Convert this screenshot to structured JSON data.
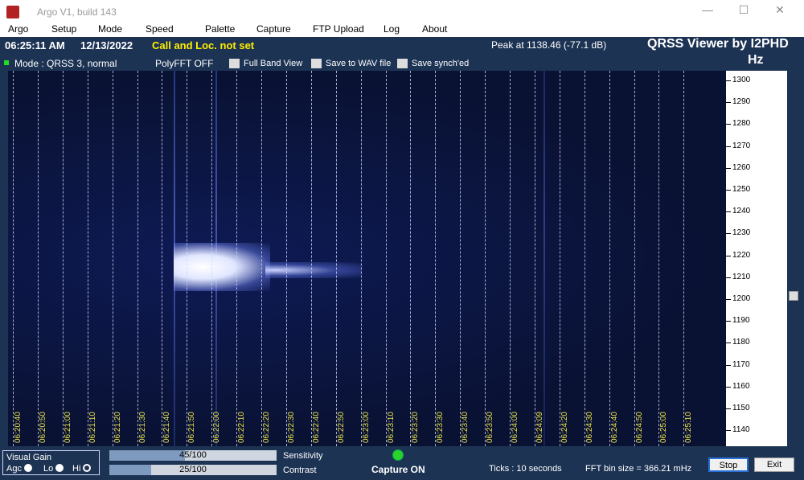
{
  "window": {
    "title": "Argo V1, build 143",
    "minimize": "—",
    "maximize": "☐",
    "close": "✕"
  },
  "menu": [
    "Argo",
    "Setup",
    "Mode",
    "Speed",
    "Palette",
    "Capture",
    "FTP Upload",
    "Log",
    "About"
  ],
  "info": {
    "time": "06:25:11 AM",
    "date": "12/13/2022",
    "call": "Call and Loc. not set",
    "peak": "Peak at   1138.46 (-77.1 dB)",
    "brand": "QRSS Viewer by I2PHD",
    "hz": "Hz",
    "mode": "Mode : QRSS 3, normal",
    "polyfft": "PolyFFT OFF",
    "checkboxes": [
      "Full Band View",
      "Save to WAV file",
      "Save synch'ed"
    ]
  },
  "time_labels": [
    "06:20:40",
    "06:20:50",
    "06:21:00",
    "06:21:10",
    "06:21:20",
    "06:21:30",
    "06:21:40",
    "06:21:50",
    "06:22:00",
    "06:22:10",
    "06:22:20",
    "06:22:30",
    "06:22:40",
    "06:22:50",
    "06:23:00",
    "06:23:10",
    "06:23:20",
    "06:23:30",
    "06:23:40",
    "06:23:50",
    "06:24:00",
    "06:24:09",
    "06:24:20",
    "06:24:30",
    "06:24:40",
    "06:24:50",
    "06:25:00",
    "06:25:10"
  ],
  "freq_labels": [
    "1300",
    "1290",
    "1280",
    "1270",
    "1260",
    "1250",
    "1240",
    "1230",
    "1220",
    "1210",
    "1200",
    "1190",
    "1180",
    "1170",
    "1160",
    "1150",
    "1140"
  ],
  "bottom": {
    "visual_gain": "Visual Gain",
    "agc": "Agc",
    "lo": "Lo",
    "hi": "Hi",
    "sensitivity_value": "45/100",
    "sensitivity_fraction": 0.45,
    "sensitivity_label": "Sensitivity",
    "contrast_value": "25/100",
    "contrast_fraction": 0.25,
    "contrast_label": "Contrast",
    "capture": "Capture ON",
    "ticks": "Ticks  : 10 seconds",
    "fft": "FFT bin size = 366.21 mHz",
    "stop": "Stop",
    "exit": "Exit"
  },
  "colors": {
    "panel": "#1d3354",
    "waterfall": "#091232",
    "time_label": "#e9e24a",
    "call_text": "#ffee00",
    "capture_led": "#2bd22b"
  }
}
